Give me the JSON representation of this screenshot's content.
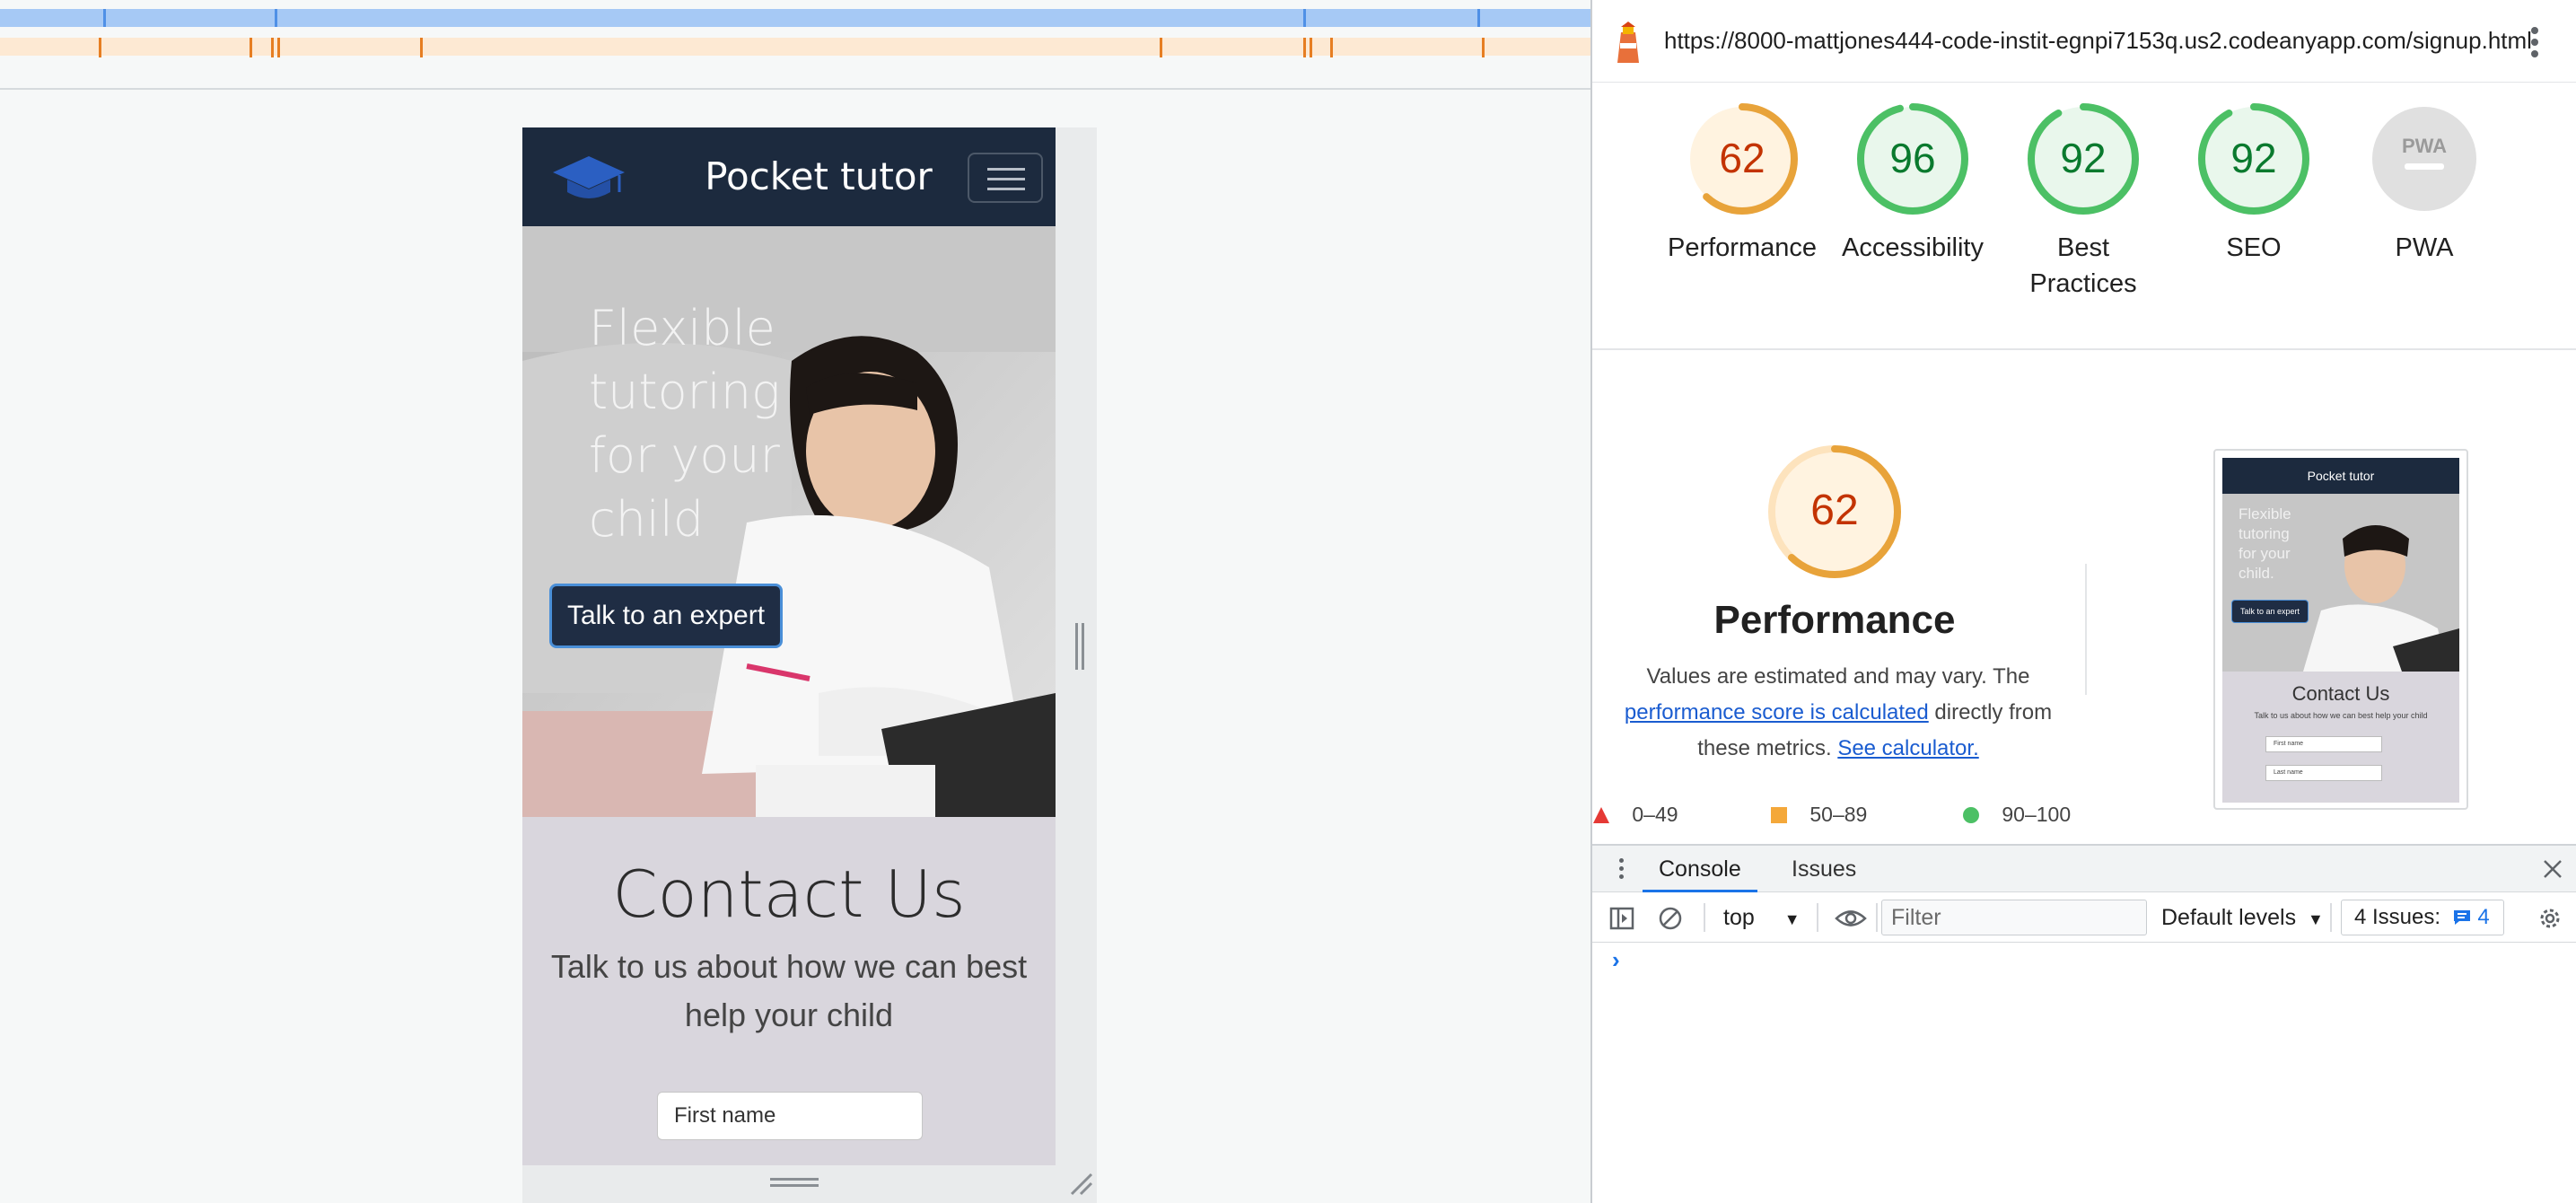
{
  "left": {
    "site": {
      "brand": "Pocket tutor",
      "hero_text": "Flexible tutoring for your child",
      "hero_button": "Talk to an expert",
      "contact_title": "Contact Us",
      "contact_subtitle": "Talk to us about how we can best help your child",
      "first_name_placeholder": "First name"
    }
  },
  "devtools": {
    "url": "https://8000-mattjones444-code-instit-egnpi7153q.us2.codeanyapp.com/signup.html",
    "scores": [
      {
        "label": "Performance",
        "value": "62",
        "fraction": 0.62,
        "color": "#e8a33a",
        "text_color": "#c33300",
        "bg": "#fff3e0"
      },
      {
        "label": "Accessibility",
        "value": "96",
        "fraction": 0.96,
        "color": "#4cc065",
        "text_color": "#0a7a2e",
        "bg": "#e9f7ec"
      },
      {
        "label": "Best Practices",
        "value": "92",
        "fraction": 0.92,
        "color": "#4cc065",
        "text_color": "#0a7a2e",
        "bg": "#e9f7ec"
      },
      {
        "label": "SEO",
        "value": "92",
        "fraction": 0.92,
        "color": "#4cc065",
        "text_color": "#0a7a2e",
        "bg": "#e9f7ec"
      },
      {
        "label": "PWA",
        "value": "PWA",
        "fraction": 0,
        "color": "#cccccc",
        "text_color": "#9a9a9a",
        "bg": "#e0e0e0"
      }
    ],
    "performance": {
      "score": "62",
      "fraction": 0.62,
      "title": "Performance",
      "desc_part1": "Values are estimated and may vary. The",
      "desc_link1": "performance score is calculated",
      "desc_part2": "directly from these metrics.",
      "desc_link2": "See calculator.",
      "legend": [
        "0–49",
        "50–89",
        "90–100"
      ]
    },
    "thumbnail": {
      "brand": "Pocket tutor",
      "hero_text": "Flexible tutoring for your child.",
      "button": "Talk to an expert",
      "contact_title": "Contact Us",
      "contact_subtitle": "Talk to us about how we can best help your child",
      "first_name": "First name",
      "last_name": "Last name"
    },
    "drawer": {
      "tabs": [
        "Console",
        "Issues"
      ],
      "context": "top",
      "filter_placeholder": "Filter",
      "levels": "Default levels",
      "issues_label": "4 Issues:",
      "issues_count": "4"
    },
    "colors": {
      "accent": "#1a73e8",
      "fail": "#e53935",
      "average": "#f4a83a",
      "pass": "#4cc065"
    }
  }
}
